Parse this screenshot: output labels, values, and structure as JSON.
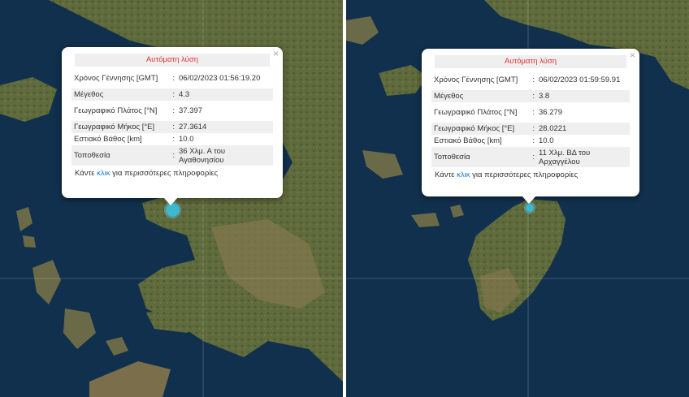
{
  "colors": {
    "sea": "#0f2c47",
    "land": "#5a6638",
    "marker": "#40b8cc",
    "title_text": "#e03232",
    "link": "#1a7ad4"
  },
  "panels": [
    {
      "popup": {
        "title": "Αυτόματη λύση",
        "close": "×",
        "rows": [
          {
            "label": "Χρόνος Γέννησης [GMT]",
            "value": "06/02/2023 01:56:19.20"
          },
          {
            "label": "Μέγεθος",
            "value": "4.3"
          },
          {
            "label": "Γεωγραφικό Πλάτος [°N]",
            "value": "37.397"
          },
          {
            "label": "Γεωγραφικό Μήκος [°E]",
            "value": "27.3614"
          },
          {
            "label": "Εστιακό Βάθος [km]",
            "value": "10.0"
          },
          {
            "label": "Τοποθεσία",
            "value": "36 Χλμ. Α του Αγαθονησίου"
          }
        ],
        "more_prefix": "Κάντε ",
        "more_link": "κλικ",
        "more_suffix": " για περισσότερες πληροφορίες"
      }
    },
    {
      "popup": {
        "title": "Αυτόματη λύση",
        "close": "×",
        "rows": [
          {
            "label": "Χρόνος Γέννησης [GMT]",
            "value": "06/02/2023 01:59:59.91"
          },
          {
            "label": "Μέγεθος",
            "value": "3.8"
          },
          {
            "label": "Γεωγραφικό Πλάτος [°N]",
            "value": "36.279"
          },
          {
            "label": "Γεωγραφικό Μήκος [°E]",
            "value": "28.0221"
          },
          {
            "label": "Εστιακό Βάθος [km]",
            "value": "10.0"
          },
          {
            "label": "Τοποθεσία",
            "value": "11 Χλμ. ΒΔ του Αρχαγγέλου"
          }
        ],
        "more_prefix": "Κάντε ",
        "more_link": "κλικ",
        "more_suffix": " για περισσότερες πληροφορίες"
      }
    }
  ]
}
